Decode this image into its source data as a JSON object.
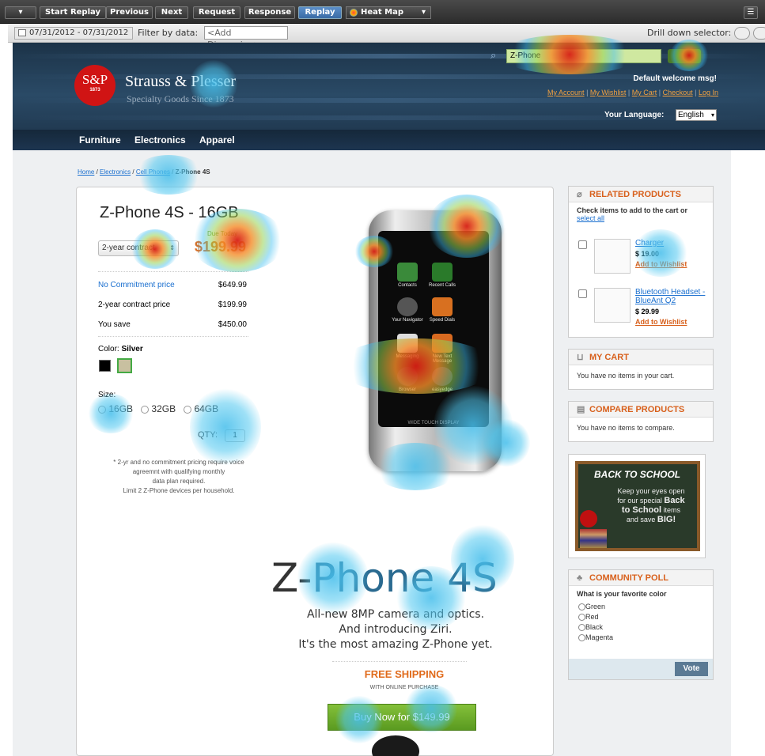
{
  "toolbar": {
    "start_replay": "Start Replay",
    "previous": "Previous",
    "next": "Next",
    "request": "Request",
    "response": "Response",
    "replay": "Replay",
    "heatmap_select": "Heat Map",
    "menu_icon": "triangle-down-icon",
    "settings_icon": "list-icon"
  },
  "filterbar": {
    "date_range": "07/31/2012 - 07/31/2012",
    "filter_label": "Filter by data:",
    "dimension_placeholder": "<Add Dimension>",
    "drill_label": "Drill down selector:"
  },
  "header": {
    "logo_badge": "S&P",
    "logo_year": "1873",
    "brand_name": "Strauss & Plesser",
    "tagline": "Specialty Goods Since 1873",
    "search_value": "Z-Phone",
    "welcome": "Default welcome msg!",
    "account_links": [
      "My Account",
      "My Wishlist",
      "My Cart",
      "Checkout",
      "Log In"
    ],
    "language_label": "Your Language:",
    "language_value": "English"
  },
  "nav": {
    "items": [
      "Furniture",
      "Electronics",
      "Apparel"
    ]
  },
  "breadcrumb": {
    "home": "Home",
    "electronics": "Electronics",
    "cell_phones": "Cell Phones",
    "current": "Z-Phone 4S"
  },
  "product": {
    "title": "Z-Phone 4S - 16GB",
    "plan_select": "2-year contract",
    "due_label": "Due Today",
    "due_price": "$199.99",
    "prices": [
      {
        "label": "No Commitment price",
        "value": "$649.99"
      },
      {
        "label": "2-year contract price",
        "value": "$199.99"
      },
      {
        "label": "You save",
        "value": "$450.00"
      }
    ],
    "color_label": "Color:",
    "color_value": "Silver",
    "size_label": "Size:",
    "sizes": [
      "16GB",
      "32GB",
      "64GB"
    ],
    "qty_label": "QTY:",
    "qty_value": "1",
    "note": [
      "* 2-yr and no commitment pricing require voice",
      "agreemnt with qualifying monthly",
      "data plan required.",
      "Limit 2 Z-Phone devices per household."
    ],
    "big_title_left": "Z-",
    "big_title_main": "Phone 4S",
    "tagline_lines": [
      "All-new 8MP camera and optics.",
      "And introducing Ziri.",
      "It's the most amazing Z-Phone yet."
    ],
    "free_shipping": "FREE SHIPPING",
    "online": "WITH ONLINE PURCHASE",
    "buy_button": "Buy Now for $149.99"
  },
  "phone_apps": [
    "Contacts",
    "Recent Calls",
    "Your Navigator",
    "Speed Dials",
    "Messaging",
    "New Text Message",
    "Browser",
    "easyedge"
  ],
  "phone_footer": "WIDE TOUCH DISPLAY",
  "related": {
    "title": "RELATED PRODUCTS",
    "intro": "Check items to add to the cart or",
    "select_all": "select all",
    "items": [
      {
        "name": "Charger",
        "price": "$ 19.00",
        "wishlist": "Add to Wishlist"
      },
      {
        "name": "Bluetooth Headset - BlueAnt Q2",
        "price": "$ 29.99",
        "wishlist": "Add to Wishlist"
      }
    ]
  },
  "cart": {
    "title": "MY CART",
    "text": "You have no items in your cart."
  },
  "compare": {
    "title": "COMPARE PRODUCTS",
    "text": "You have no items to compare."
  },
  "promo": {
    "title": "BACK TO SCHOOL",
    "line1": "Keep your eyes open",
    "line2": "for our special",
    "bold1": "Back",
    "bold2": "to School",
    "line3": "items",
    "line4": "and save",
    "bold3": "BIG!"
  },
  "poll": {
    "title": "COMMUNITY POLL",
    "question": "What is your favorite color",
    "options": [
      "Green",
      "Red",
      "Black",
      "Magenta"
    ],
    "vote": "Vote"
  },
  "colors": {
    "accent": "#d8601c",
    "header": "#1c3348",
    "link": "#1a6fcf",
    "buy": "#6ea52a",
    "price": "#e06a1a"
  }
}
